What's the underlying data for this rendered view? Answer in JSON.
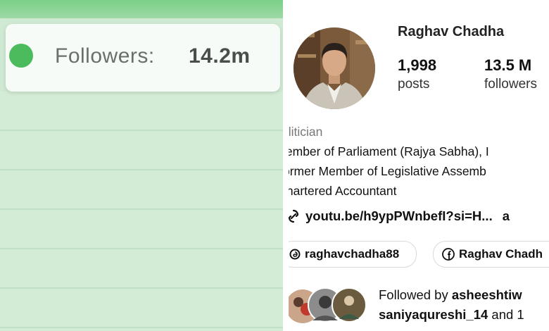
{
  "left_panel": {
    "followers_label": "Followers:",
    "followers_value": "14.2m",
    "accent": "#4cbb5e"
  },
  "profile": {
    "username": "Raghav Chadha",
    "stats": [
      {
        "value": "1,998",
        "label": "posts"
      },
      {
        "value": "13.5 M",
        "label": "followers"
      }
    ],
    "category": "olitician",
    "bio": [
      "lember of Parliament (Rajya Sabha), I",
      "ormer Member of Legislative Assemb",
      ":hartered Accountant"
    ],
    "link_text": "youtu.be/h9ypPWnbefI?si=H...",
    "link_suffix": "a",
    "link_icon": "link-icon",
    "chips": [
      {
        "icon": "threads-icon",
        "label": "raghavchadha88"
      },
      {
        "icon": "facebook-icon",
        "label": "Raghav Chadh"
      }
    ],
    "followed_by_prefix": "Followed by ",
    "followed_by_user1": "asheeshtiw",
    "followed_by_user2": "saniyaqureshi_14",
    "followed_by_suffix": " and 1"
  }
}
